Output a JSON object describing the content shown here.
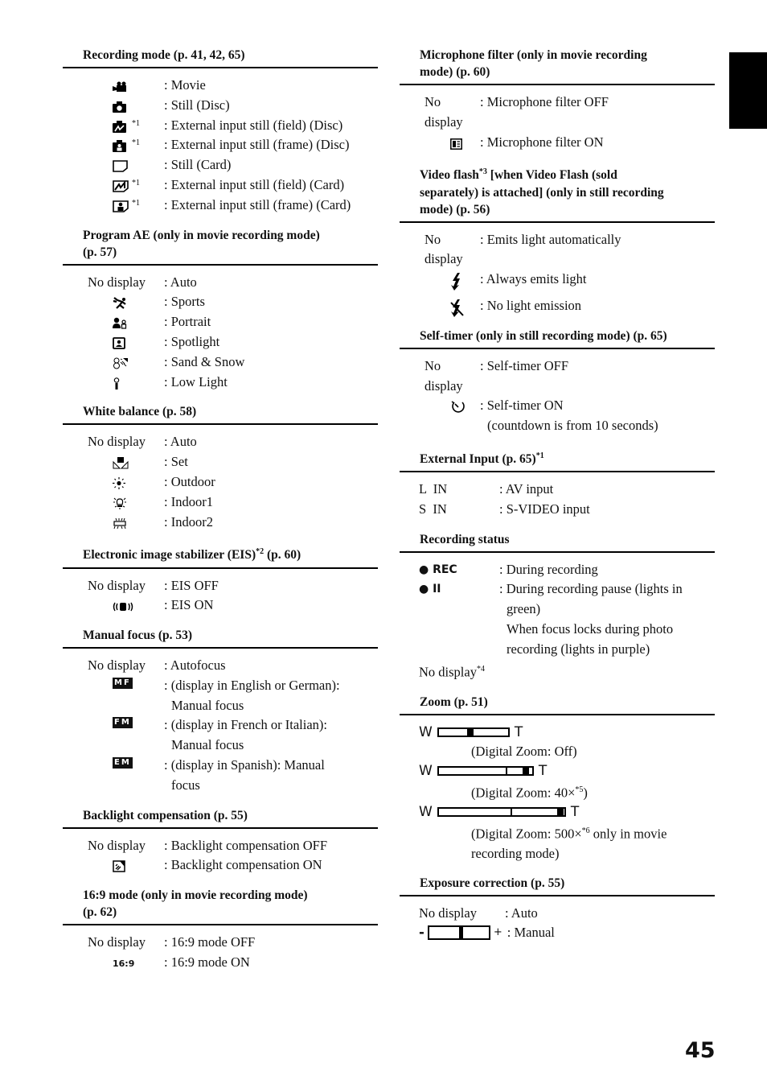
{
  "page_number": "45",
  "left_column": {
    "recording_mode": {
      "title": "Recording mode (p. 41, 42, 65)",
      "rows": [
        {
          "icon": "movie-camera-icon",
          "note": "",
          "desc": ": Movie"
        },
        {
          "icon": "camera-icon",
          "note": "",
          "desc": ": Still (Disc)"
        },
        {
          "icon": "camera-field-icon",
          "note": "*1",
          "desc": ": External input still (field) (Disc)"
        },
        {
          "icon": "camera-frame-icon",
          "note": "*1",
          "desc": ": External input still (frame) (Disc)"
        },
        {
          "icon": "card-icon",
          "note": "",
          "desc": ": Still (Card)"
        },
        {
          "icon": "card-field-icon",
          "note": "*1",
          "desc": ": External input still (field) (Card)"
        },
        {
          "icon": "card-frame-icon",
          "note": "*1",
          "desc": ": External input still (frame) (Card)"
        }
      ]
    },
    "program_ae": {
      "title_line1": "Program AE (only in movie recording mode)",
      "title_line2": "(p. 57)",
      "no_display": "No display",
      "auto": ": Auto",
      "rows": [
        {
          "icon": "sports-icon",
          "desc": ": Sports"
        },
        {
          "icon": "portrait-icon",
          "desc": ": Portrait"
        },
        {
          "icon": "spotlight-icon",
          "desc": ": Spotlight"
        },
        {
          "icon": "sand-snow-icon",
          "desc": ": Sand & Snow"
        },
        {
          "icon": "low-light-icon",
          "desc": ": Low Light"
        }
      ]
    },
    "white_balance": {
      "title": "White balance (p. 58)",
      "no_display": "No display",
      "auto": ": Auto",
      "rows": [
        {
          "icon": "wb-set-icon",
          "desc": ": Set"
        },
        {
          "icon": "sun-icon",
          "desc": ": Outdoor"
        },
        {
          "icon": "bulb-icon",
          "desc": ": Indoor1"
        },
        {
          "icon": "fluorescent-icon",
          "desc": ": Indoor2"
        }
      ]
    },
    "eis": {
      "title": "Electronic image stabilizer (EIS)",
      "title_note": "*2",
      "title_page": " (p. 60)",
      "no_display": "No display",
      "off": ": EIS OFF",
      "on_icon": "steady-hand-icon",
      "on": ": EIS ON"
    },
    "manual_focus": {
      "title": "Manual focus (p. 53)",
      "no_display": "No display",
      "auto": ": Autofocus",
      "rows": [
        {
          "badge": "MF",
          "line1": ": (display in English or German):",
          "line2": "Manual focus"
        },
        {
          "badge": "FM",
          "line1": ": (display in French or Italian):",
          "line2": "Manual focus"
        },
        {
          "badge": "EM",
          "line1": ": (display in Spanish): Manual",
          "line2": "focus"
        }
      ]
    },
    "backlight": {
      "title": "Backlight compensation (p. 55)",
      "no_display": "No display",
      "off": ": Backlight compensation OFF",
      "on_icon": "backlight-icon",
      "on": ": Backlight compensation ON"
    },
    "wide_mode": {
      "title_line1": "16:9 mode (only in movie recording mode)",
      "title_line2": "(p. 62)",
      "no_display": "No display",
      "off": ": 16:9 mode OFF",
      "on_icon_text": "16:9",
      "on": ": 16:9 mode ON"
    }
  },
  "right_column": {
    "mic_filter": {
      "title_line1": "Microphone filter (only in movie recording",
      "title_line2": "mode) (p. 60)",
      "no_display": "No display",
      "off": ": Microphone filter OFF",
      "on_icon": "mic-filter-icon",
      "on": ": Microphone filter ON"
    },
    "video_flash": {
      "title_a": "Video flash",
      "title_note": "*3",
      "title_b": " [when Video Flash (sold",
      "title_line2": "separately) is attached] (only in still recording",
      "title_line3": "mode) (p. 56)",
      "no_display": "No display",
      "auto": ": Emits light automatically",
      "always_icon": "flash-icon",
      "always": ": Always emits light",
      "none_icon": "flash-off-icon",
      "none": ": No light emission"
    },
    "self_timer": {
      "title": "Self-timer (only in still recording mode) (p. 65)",
      "no_display": "No display",
      "off": ": Self-timer OFF",
      "on_icon": "self-timer-icon",
      "on": ": Self-timer ON",
      "on_line2": "(countdown is from 10 seconds)"
    },
    "external_input": {
      "title": "External Input (p. 65)",
      "title_note": "*1",
      "rows": [
        {
          "label": "L  IN",
          "desc": ": AV input"
        },
        {
          "label": "S  IN",
          "desc": ": S-VIDEO input"
        }
      ]
    },
    "recording_status": {
      "title": "Recording status",
      "rec_label": "● REC",
      "rec_desc": ": During recording",
      "pause_label": "● II",
      "pause_desc_1": ": During recording pause (lights in",
      "pause_desc_2": "green)",
      "pause_desc_3": "When focus locks during photo",
      "pause_desc_4": "recording (lights in purple)",
      "no_display": "No display",
      "no_display_note": "*4"
    },
    "zoom": {
      "title": "Zoom (p. 51)",
      "w": "W",
      "t": "T",
      "bars": [
        {
          "caption": "(Digital Zoom: Off)",
          "note": "",
          "caption_tail": "",
          "position": 0.45
        },
        {
          "caption": "(Digital Zoom: 40×",
          "note": "*5",
          "caption_tail": ")",
          "position": 0.93
        },
        {
          "caption": "(Digital Zoom: 500×",
          "note": "*6",
          "caption_tail": " only in movie",
          "caption_line2": "recording mode)",
          "position": 0.97
        }
      ]
    },
    "exposure": {
      "title": "Exposure correction (p. 55)",
      "no_display": "No display",
      "auto": ": Auto",
      "minus": "-",
      "plus": "+",
      "manual": ": Manual"
    }
  }
}
